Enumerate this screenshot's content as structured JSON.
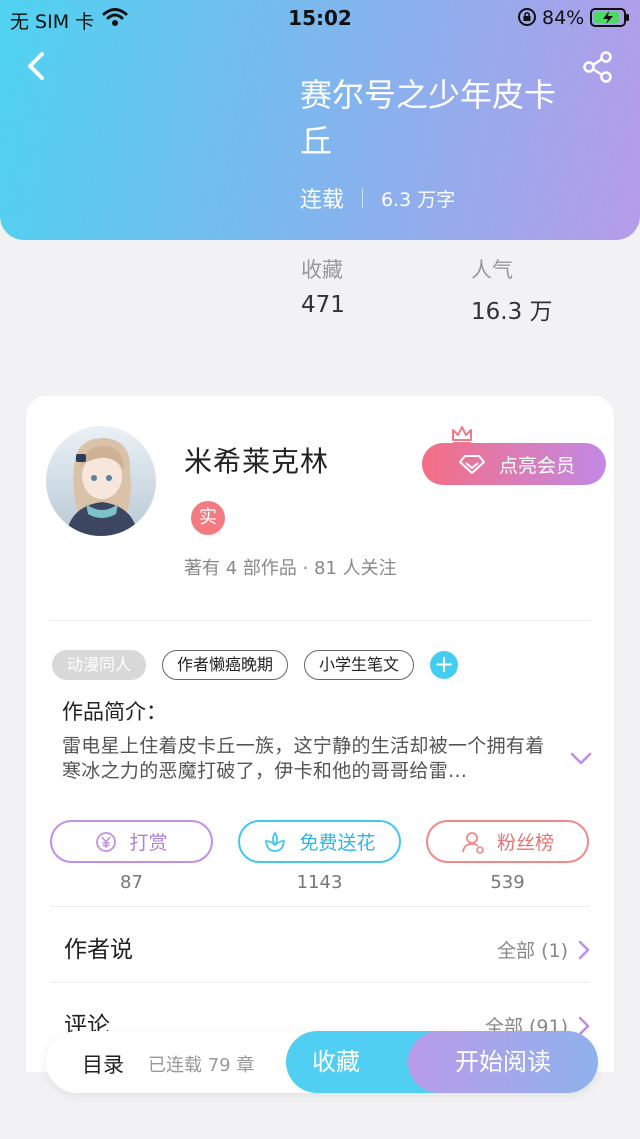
{
  "status_bar": {
    "carrier": "无 SIM 卡",
    "time": "15:02",
    "battery": "84%"
  },
  "header": {
    "title": "赛尔号之少年皮卡丘",
    "status": "连载",
    "word_count": "6.3 万字"
  },
  "stats": [
    {
      "label": "收藏",
      "value": "471"
    },
    {
      "label": "人气",
      "value": "16.3 万"
    }
  ],
  "author": {
    "name": "米希莱克林",
    "badge": "实",
    "stats": "著有 4 部作品 · 81 人关注",
    "vip_label": "点亮会员"
  },
  "tags": [
    "动漫同人",
    "作者懒癌晚期",
    "小学生笔文"
  ],
  "intro": {
    "title": "作品简介：",
    "text": "雷电星上住着皮卡丘一族，这宁静的生活却被一个拥有着寒冰之力的恶魔打破了，伊卡和他的哥哥给雷…"
  },
  "actions": [
    {
      "label": "打赏",
      "count": "87",
      "color": "#c48fe6",
      "icon": "yen-coin-icon"
    },
    {
      "label": "免费送花",
      "count": "1143",
      "color": "#45c8ef",
      "icon": "flower-icon"
    },
    {
      "label": "粉丝榜",
      "count": "539",
      "color": "#f08a8a",
      "icon": "person-icon"
    }
  ],
  "sections": {
    "author_says": {
      "title": "作者说",
      "more": "全部 (1)"
    },
    "comments": {
      "title": "评论",
      "more": "全部 (91)"
    }
  },
  "bottom_bar": {
    "toc": "目录",
    "chapters": "已连载 79 章",
    "favorite": "收藏",
    "read": "开始阅读"
  },
  "colors": {
    "accent_cyan": "#50cff2",
    "accent_purple": "#b99be9",
    "chevron": "#c08ce6"
  }
}
